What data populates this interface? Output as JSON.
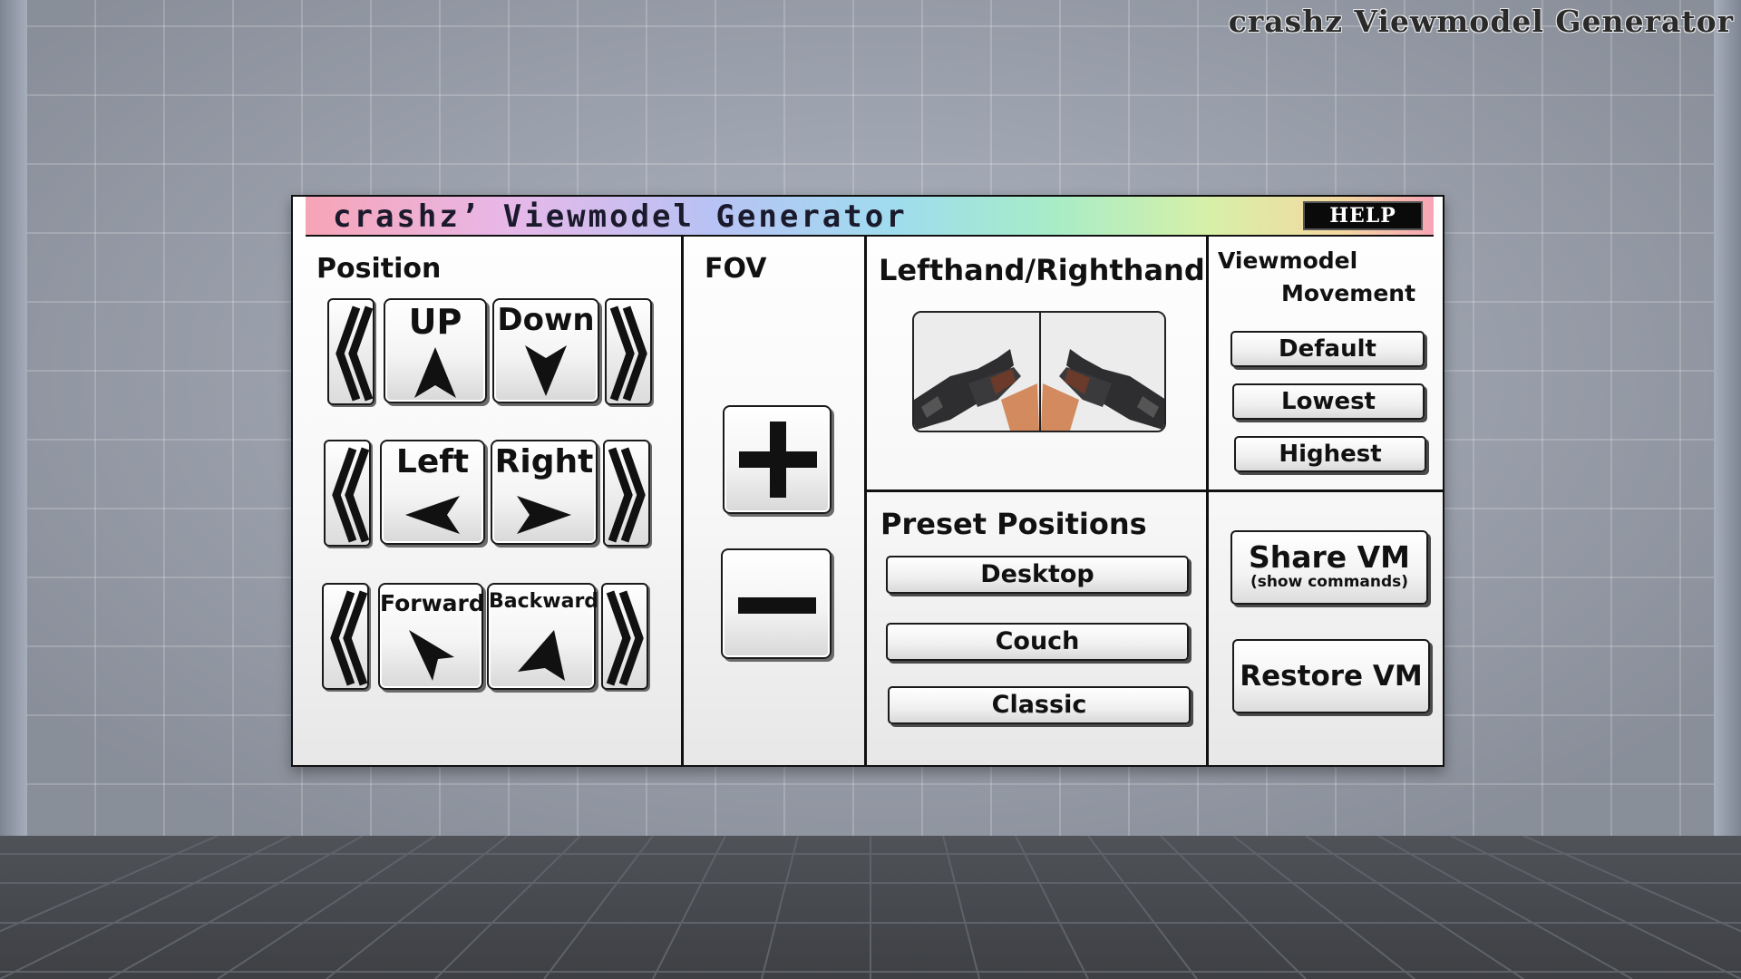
{
  "hud": {
    "title": "crashz Viewmodel Generator"
  },
  "board": {
    "title": "crashz’ Viewmodel Generator",
    "help_label": "HELP",
    "title_gradient": [
      "#f7a4b6",
      "#b8c2f4",
      "#9fdcef",
      "#a6ecc8",
      "#d7f0a8"
    ]
  },
  "position": {
    "label": "Position",
    "rows": [
      {
        "a_label": "UP",
        "b_label": "Down"
      },
      {
        "a_label": "Left",
        "b_label": "Right"
      },
      {
        "a_label": "Forward",
        "b_label": "Backward"
      }
    ]
  },
  "fov": {
    "label": "FOV",
    "plus_icon": "plus-icon",
    "minus_icon": "minus-icon"
  },
  "hands": {
    "label": "Lefthand/Righthand",
    "left_icon": "rifle-lefthand-icon",
    "right_icon": "rifle-righthand-icon"
  },
  "movement": {
    "label_line1": "Viewmodel",
    "label_line2": "Movement",
    "buttons": [
      "Default",
      "Lowest",
      "Highest"
    ]
  },
  "presets": {
    "label": "Preset Positions",
    "buttons": [
      "Desktop",
      "Couch",
      "Classic"
    ]
  },
  "share": {
    "label": "Share VM",
    "sublabel": "(show commands)"
  },
  "restore": {
    "label": "Restore VM"
  }
}
